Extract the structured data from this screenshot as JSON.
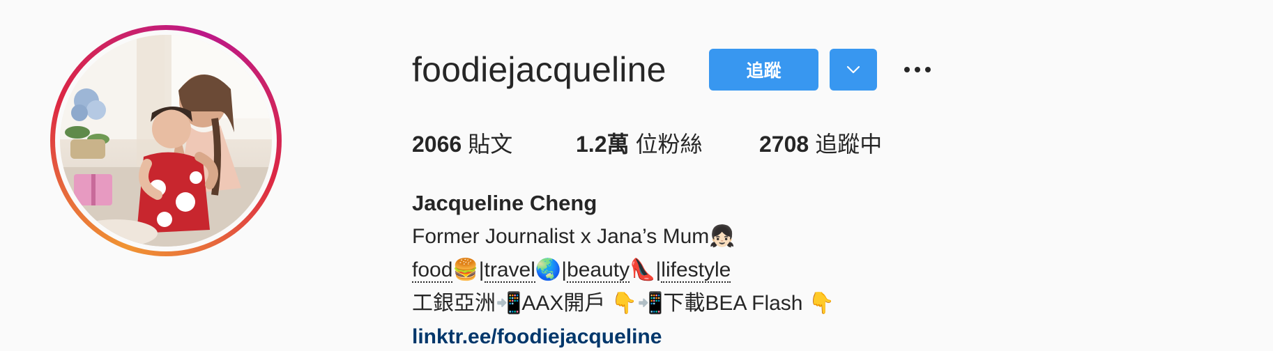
{
  "profile": {
    "username": "foodiejacqueline",
    "follow_label": "追蹤",
    "dropdown_icon": "chevron-down-icon",
    "more_icon": "more-options-icon"
  },
  "stats": {
    "posts_count": "2066",
    "posts_label": "貼文",
    "followers_count": "1.2萬",
    "followers_label": "位粉絲",
    "following_count": "2708",
    "following_label": "追蹤中"
  },
  "bio": {
    "full_name": "Jacqueline Cheng",
    "line1": "Former Journalist x Jana’s Mum👧🏻",
    "line2_parts": [
      {
        "text": "food",
        "dotted": true
      },
      {
        "text": "🍔|",
        "dotted": false
      },
      {
        "text": "travel",
        "dotted": true
      },
      {
        "text": "🌏|",
        "dotted": false
      },
      {
        "text": "beauty",
        "dotted": true
      },
      {
        "text": "👠|",
        "dotted": false
      },
      {
        "text": "lifestyle",
        "dotted": true
      }
    ],
    "line3": "工銀亞洲📲AAX開戶 👇📲下載BEA Flash 👇",
    "link": "linktr.ee/foodiejacqueline"
  },
  "colors": {
    "background": "#fafafa",
    "button_blue": "#3897f0",
    "link_color": "#00376b",
    "text": "#262626"
  }
}
